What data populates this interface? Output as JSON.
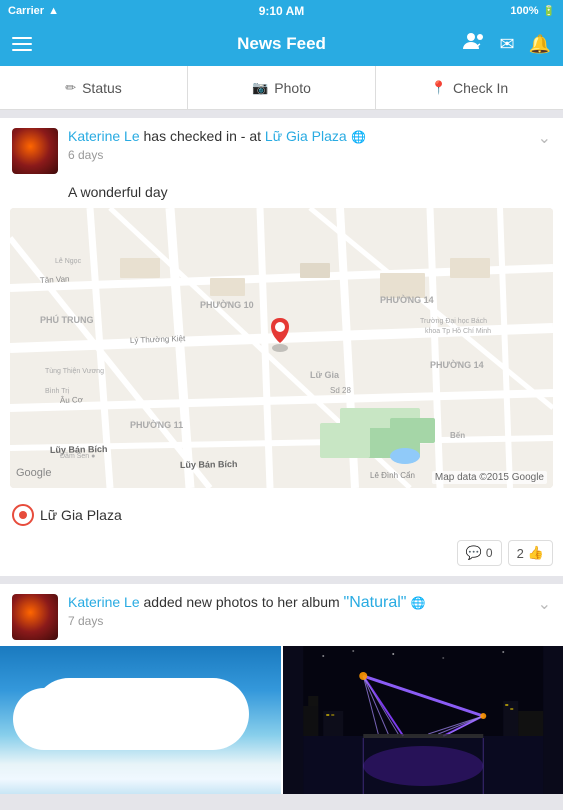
{
  "statusBar": {
    "carrier": "Carrier",
    "time": "9:10 AM",
    "battery": "100%",
    "wifi": true
  },
  "navBar": {
    "title": "News Feed",
    "menuIcon": "≡",
    "friendsIcon": "👥",
    "messageIcon": "✉",
    "notificationIcon": "🔔"
  },
  "tabs": [
    {
      "id": "status",
      "icon": "✏",
      "label": "Status"
    },
    {
      "id": "photo",
      "icon": "📷",
      "label": "Photo"
    },
    {
      "id": "checkin",
      "icon": "📍",
      "label": "Check In"
    }
  ],
  "posts": [
    {
      "id": "post1",
      "author": "Katerine Le",
      "action": " has checked in - at ",
      "location": "Lữ Gia Plaza",
      "timeAgo": "6 days",
      "text": "A wonderful day",
      "locationTag": "Lữ Gia Plaza",
      "mapWatermark": "Map data ©2015 Google",
      "reactions": {
        "comments": "0",
        "likes": "2"
      }
    },
    {
      "id": "post2",
      "author": "Katerine Le",
      "action": " added new photos to her album ",
      "albumName": "\"Natural\"",
      "timeAgo": "7 days"
    }
  ],
  "icons": {
    "globe": "🌐",
    "pin": "📍",
    "like": "👍",
    "comment": "💬",
    "chevronDown": "⌄",
    "googleLogo": "G"
  }
}
